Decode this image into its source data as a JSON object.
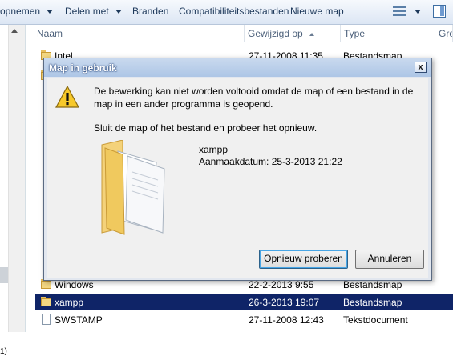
{
  "toolbar": {
    "items": [
      {
        "label": "opnemen",
        "dropdown": true
      },
      {
        "label": "Delen met",
        "dropdown": true
      },
      {
        "label": "Branden",
        "dropdown": false
      },
      {
        "label": "Compatibiliteitsbestanden",
        "dropdown": false
      },
      {
        "label": "Nieuwe map",
        "dropdown": false
      }
    ],
    "icons": [
      "view-options-icon",
      "preview-pane-icon"
    ]
  },
  "nav": {
    "partial_text": "1)"
  },
  "columns": {
    "name": "Naam",
    "modified": "Gewijzigd op",
    "type": "Type",
    "size": "Gro"
  },
  "files": [
    {
      "name": "Intel",
      "modified": "27-11-2008 11:35",
      "type": "Bestandsmap",
      "icon": "folder-icon"
    },
    {
      "name": "Windows",
      "modified": "22-2-2013 9:55",
      "type": "Bestandsmap",
      "icon": "folder-icon"
    },
    {
      "name": "xampp",
      "modified": "26-3-2013 19:07",
      "type": "Bestandsmap",
      "icon": "folder-icon",
      "selected": true
    },
    {
      "name": "SWSTAMP",
      "modified": "27-11-2008 12:43",
      "type": "Tekstdocument",
      "icon": "document-icon"
    }
  ],
  "dialog": {
    "title": "Map in gebruik",
    "close_label": "x",
    "message_line1": "De bewerking kan niet worden voltooid omdat de map of een bestand in de",
    "message_line2": "map in een ander programma is geopend.",
    "instruction": "Sluit de map of het bestand en probeer het opnieuw.",
    "item_name": "xampp",
    "item_date": "Aanmaakdatum: 25-3-2013 21:22",
    "retry_label": "Opnieuw proberen",
    "cancel_label": "Annuleren",
    "icon": "warning-icon"
  },
  "colors": {
    "selection": "#0f2467",
    "titlebar": "#adc6e6",
    "dialog_bg": "#f0f0f0"
  }
}
